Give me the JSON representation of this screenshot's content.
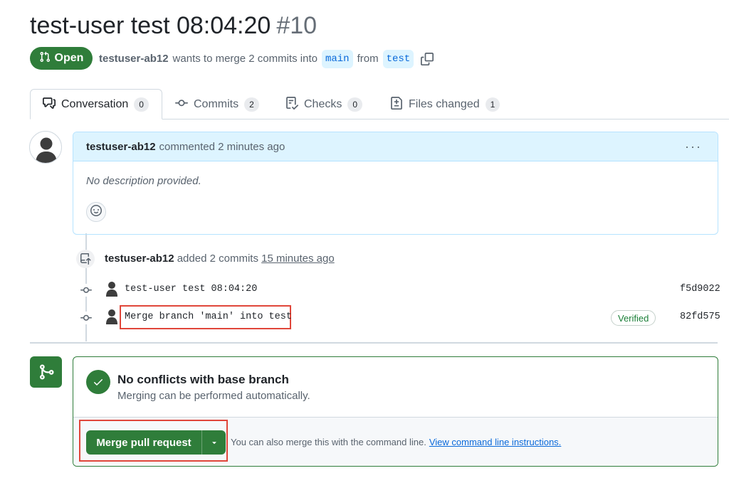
{
  "pr": {
    "title": "test-user test 08:04:20",
    "number": "#10",
    "state": "Open",
    "author": "testuser-ab12",
    "summary": "wants to merge 2 commits into",
    "base_branch": "main",
    "from_word": "from",
    "head_branch": "test"
  },
  "tabs": [
    {
      "label": "Conversation",
      "count": "0",
      "icon": "conversation-icon"
    },
    {
      "label": "Commits",
      "count": "2",
      "icon": "commit-icon"
    },
    {
      "label": "Checks",
      "count": "0",
      "icon": "checks-icon"
    },
    {
      "label": "Files changed",
      "count": "1",
      "icon": "file-diff-icon"
    }
  ],
  "comment": {
    "author": "testuser-ab12",
    "action": "commented 2 minutes ago",
    "menu": "···",
    "body": "No description provided."
  },
  "commits_event": {
    "author": "testuser-ab12",
    "action": "added 2 commits",
    "time": "15 minutes ago",
    "commits": [
      {
        "message": "test-user test 08:04:20",
        "sha": "f5d9022",
        "verified": ""
      },
      {
        "message": "Merge branch 'main' into test",
        "sha": "82fd575",
        "verified": "Verified"
      }
    ]
  },
  "merge": {
    "status_title": "No conflicts with base branch",
    "status_subtitle": "Merging can be performed automatically.",
    "button_label": "Merge pull request",
    "cli_text": "You can also merge this with the command line.",
    "cli_link": "View command line instructions."
  },
  "colors": {
    "accent_green": "#2f7d3a",
    "link_blue": "#0969da",
    "highlight_red": "#e0463a"
  }
}
